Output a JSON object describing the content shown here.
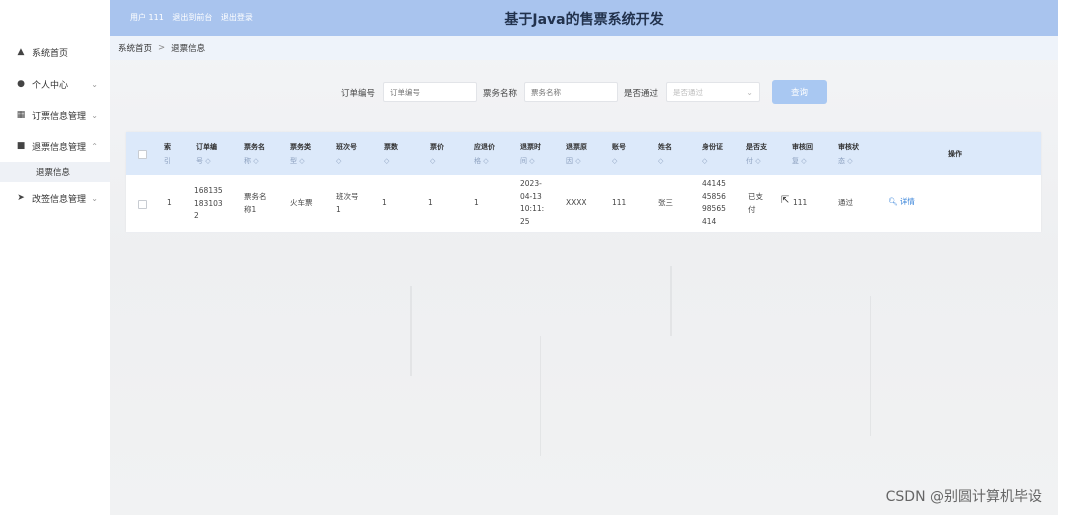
{
  "header": {
    "user_label": "用户 111",
    "backend_link": "退出到前台",
    "logout_link": "退出登录",
    "title": "基于Java的售票系统开发"
  },
  "sidebar": {
    "items": [
      {
        "label": "系统首页",
        "icon": "home-icon",
        "has_chevron": false
      },
      {
        "label": "个人中心",
        "icon": "user-icon",
        "has_chevron": true
      },
      {
        "label": "订票信息管理",
        "icon": "grid-icon",
        "has_chevron": true
      },
      {
        "label": "退票信息管理",
        "icon": "folder-icon",
        "has_chevron": true,
        "expanded": true
      },
      {
        "label": "改签信息管理",
        "icon": "send-icon",
        "has_chevron": true
      }
    ],
    "active_sub": "退票信息"
  },
  "breadcrumb": {
    "home": "系统首页",
    "separator": ">",
    "current": "退票信息"
  },
  "search": {
    "order_label": "订单编号",
    "order_placeholder": "订单编号",
    "ticket_label": "票务名称",
    "ticket_placeholder": "票务名称",
    "pass_label": "是否通过",
    "pass_placeholder": "是否通过",
    "query_button": "查询"
  },
  "table": {
    "sort_marker": "◇",
    "headers": [
      {
        "key": "index",
        "l1": "索",
        "l2": "引"
      },
      {
        "key": "order_no",
        "l1": "订单编",
        "l2": "号"
      },
      {
        "key": "ticket_name",
        "l1": "票务名",
        "l2": "称"
      },
      {
        "key": "ticket_type",
        "l1": "票务类",
        "l2": "型"
      },
      {
        "key": "train_no",
        "l1": "班次号",
        "l2": ""
      },
      {
        "key": "count",
        "l1": "票数",
        "l2": ""
      },
      {
        "key": "price",
        "l1": "票价",
        "l2": ""
      },
      {
        "key": "amount",
        "l1": "应退价",
        "l2": "格"
      },
      {
        "key": "refund_time",
        "l1": "退票时",
        "l2": "间"
      },
      {
        "key": "refund_reason",
        "l1": "退票原",
        "l2": "因"
      },
      {
        "key": "account",
        "l1": "账号",
        "l2": ""
      },
      {
        "key": "name",
        "l1": "姓名",
        "l2": ""
      },
      {
        "key": "id_card",
        "l1": "身份证",
        "l2": ""
      },
      {
        "key": "paid",
        "l1": "是否支",
        "l2": "付"
      },
      {
        "key": "review_reply",
        "l1": "审核回",
        "l2": "复"
      },
      {
        "key": "review_status",
        "l1": "审核状",
        "l2": "态"
      },
      {
        "key": "actions",
        "l1": "操作",
        "l2": ""
      }
    ],
    "rows": [
      {
        "index": "1",
        "order_no": [
          "168135",
          "183103",
          "2"
        ],
        "ticket_name": [
          "票务名",
          "称1"
        ],
        "ticket_type": "火车票",
        "train_no": [
          "班次号",
          "1"
        ],
        "count": "1",
        "price": "1",
        "amount": "1",
        "refund_time": [
          "2023-",
          "04-13",
          "10:11:",
          "25"
        ],
        "refund_reason": "XXXX",
        "account": "111",
        "name": "张三",
        "id_card": [
          "44145",
          "45856",
          "98565",
          "414"
        ],
        "paid": [
          "已支",
          "付"
        ],
        "review_reply": "111",
        "review_status": "通过",
        "detail_icon": "search-icon",
        "detail_label": "详情"
      }
    ]
  },
  "watermark": "CSDN @别圆计算机毕设",
  "colors": {
    "header_bg": "#a9c4ee",
    "table_head_bg": "#dce9fa",
    "button_bg": "#a9c8f2",
    "link": "#2f7ed8"
  }
}
